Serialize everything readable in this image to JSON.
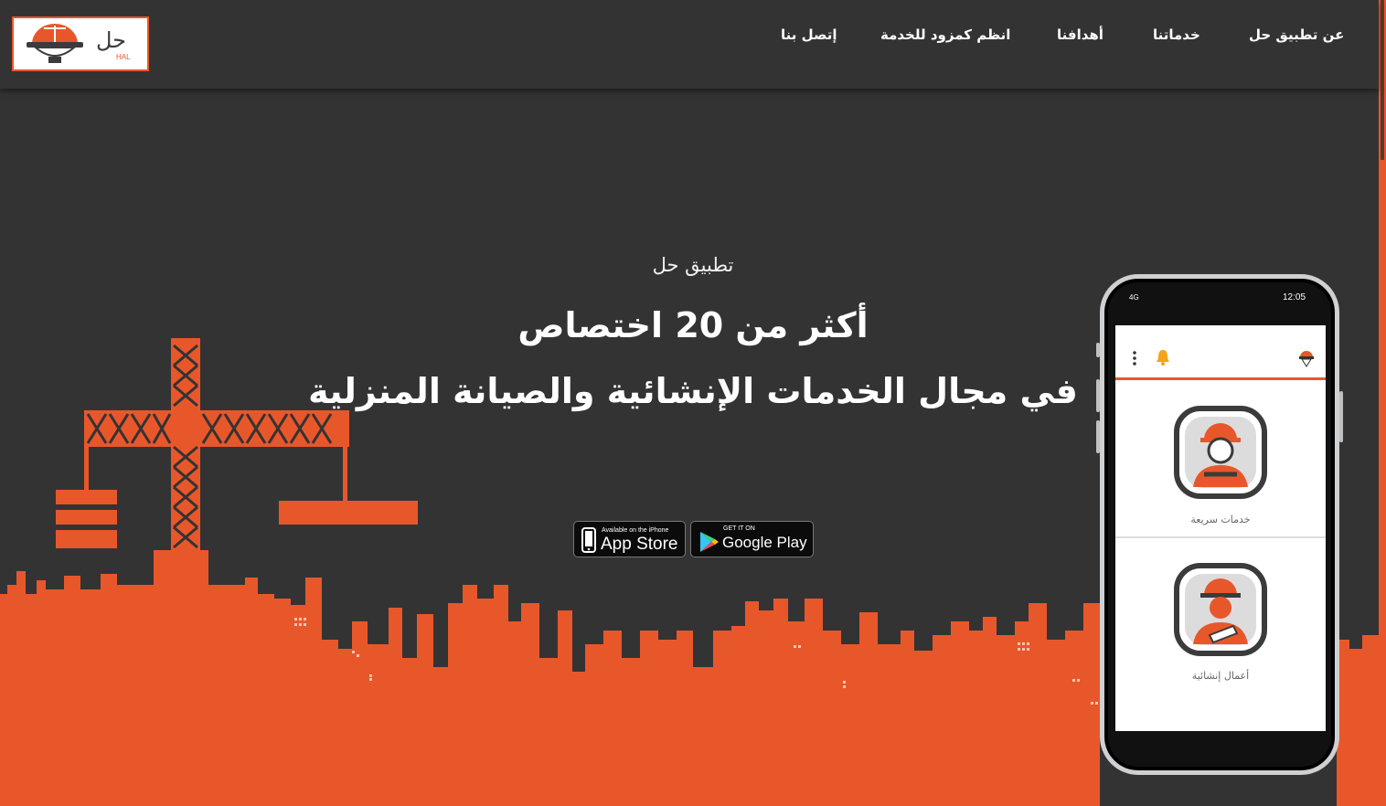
{
  "brand": {
    "logo_ar": "حل",
    "logo_en": "HAL"
  },
  "nav": {
    "items": [
      {
        "label": "عن تطبيق حل"
      },
      {
        "label": "خدماتنا"
      },
      {
        "label": "أهدافنا"
      },
      {
        "label": "انظم كمزود للخدمة"
      },
      {
        "label": "إتصل بنا"
      }
    ]
  },
  "hero": {
    "subtitle": "تطبيق حل",
    "title_line1": "أكثر من 20 اختصاص",
    "title_line2": "في مجال الخدمات الإنشائية والصيانة المنزلية"
  },
  "stores": {
    "appstore_small": "Available on the iPhone",
    "appstore_big": "App Store",
    "play_small": "GET IT ON",
    "play_big": "Google Play"
  },
  "phone": {
    "time": "12:05",
    "network": "4G",
    "tiles": [
      {
        "label": "خدمات سريعة",
        "icon": "mechanic-icon"
      },
      {
        "label": "أعمال إنشائية",
        "icon": "engineer-icon"
      }
    ]
  },
  "colors": {
    "accent": "#e8572a",
    "background": "#343334"
  }
}
